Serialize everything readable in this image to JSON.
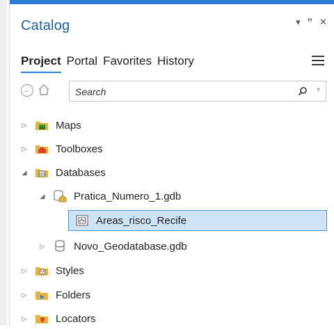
{
  "pane": {
    "title": "Catalog",
    "controls": [
      "▾",
      "ꟸ",
      "✕"
    ]
  },
  "tabs": [
    {
      "label": "Project",
      "active": true
    },
    {
      "label": "Portal",
      "active": false
    },
    {
      "label": "Favorites",
      "active": false
    },
    {
      "label": "History",
      "active": false
    }
  ],
  "search": {
    "placeholder": "Search"
  },
  "tree": [
    {
      "label": "Maps",
      "icon": "maps-folder-icon",
      "caret": "▷"
    },
    {
      "label": "Toolboxes",
      "icon": "toolbox-folder-icon",
      "caret": "▷"
    },
    {
      "label": "Databases",
      "icon": "databases-folder-icon",
      "caret": "◢"
    },
    {
      "label": "Pratica_Numero_1.gdb",
      "icon": "geodatabase-home-icon",
      "caret": "◢"
    },
    {
      "label": "Areas_risco_Recife",
      "icon": "feature-class-icon",
      "caret": "",
      "selected": true
    },
    {
      "label": "Novo_Geodatabase.gdb",
      "icon": "geodatabase-icon",
      "caret": "▷"
    },
    {
      "label": "Styles",
      "icon": "styles-folder-icon",
      "caret": "▷"
    },
    {
      "label": "Folders",
      "icon": "folders-folder-icon",
      "caret": "▷"
    },
    {
      "label": "Locators",
      "icon": "locators-folder-icon",
      "caret": "▷"
    }
  ],
  "colors": {
    "accent": "#2c7cd6",
    "selection": "#cfe3f7",
    "folder": "#e9b43c"
  }
}
